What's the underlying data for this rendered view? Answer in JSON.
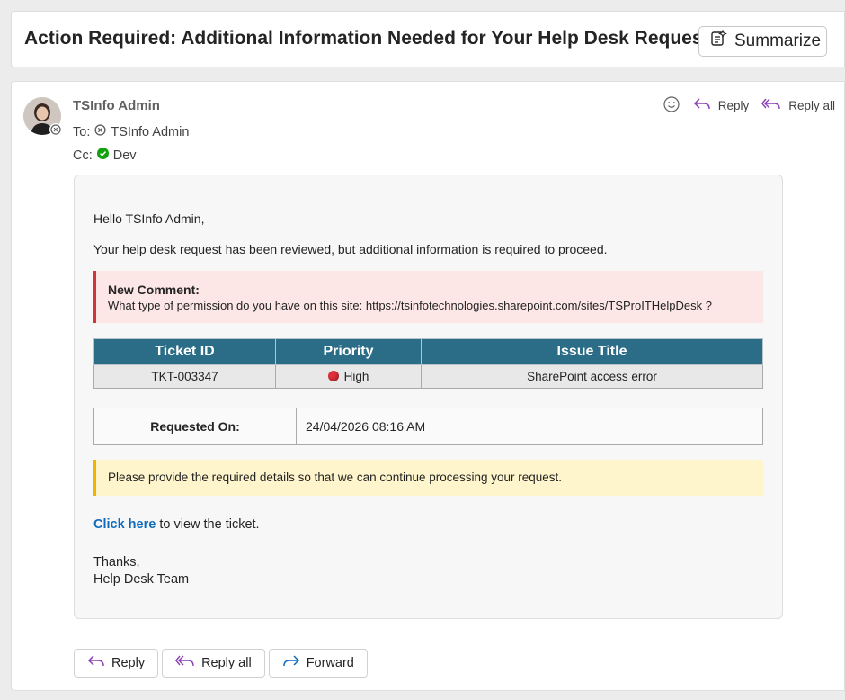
{
  "subject": "Action Required: Additional Information Needed for Your Help Desk Request",
  "summarize_label": "Summarize",
  "sender": "TSInfo Admin",
  "to": {
    "label": "To:",
    "name": "TSInfo Admin"
  },
  "cc": {
    "label": "Cc:",
    "name": "Dev"
  },
  "top_actions": {
    "reply": "Reply",
    "reply_all": "Reply all"
  },
  "body": {
    "greeting": "Hello TSInfo Admin,",
    "intro": "Your help desk request has been reviewed, but additional information is required to proceed.",
    "comment_title": "New Comment:",
    "comment_text": "What type of permission do you have on this site: https://tsinfotechnologies.sharepoint.com/sites/TSProITHelpDesk ?",
    "ticket_headers": [
      "Ticket ID",
      "Priority",
      "Issue Title"
    ],
    "ticket_row": {
      "id": "TKT-003347",
      "priority": "High",
      "title": "SharePoint access error"
    },
    "requested_label": "Requested On:",
    "requested_value": "24/04/2026 08:16 AM",
    "notice": "Please provide the required details so that we can continue processing your request.",
    "link_text": "Click here",
    "link_suffix": " to view the ticket.",
    "thanks": "Thanks,",
    "signature": "Help Desk Team"
  },
  "bottom_actions": {
    "reply": "Reply",
    "reply_all": "Reply all",
    "forward": "Forward"
  },
  "colors": {
    "table_header": "#2b6d86",
    "comment_bar": "#d13438",
    "notice_bar": "#f0b400",
    "link": "#0f6cbd",
    "priority_dot": "#e0303c"
  }
}
